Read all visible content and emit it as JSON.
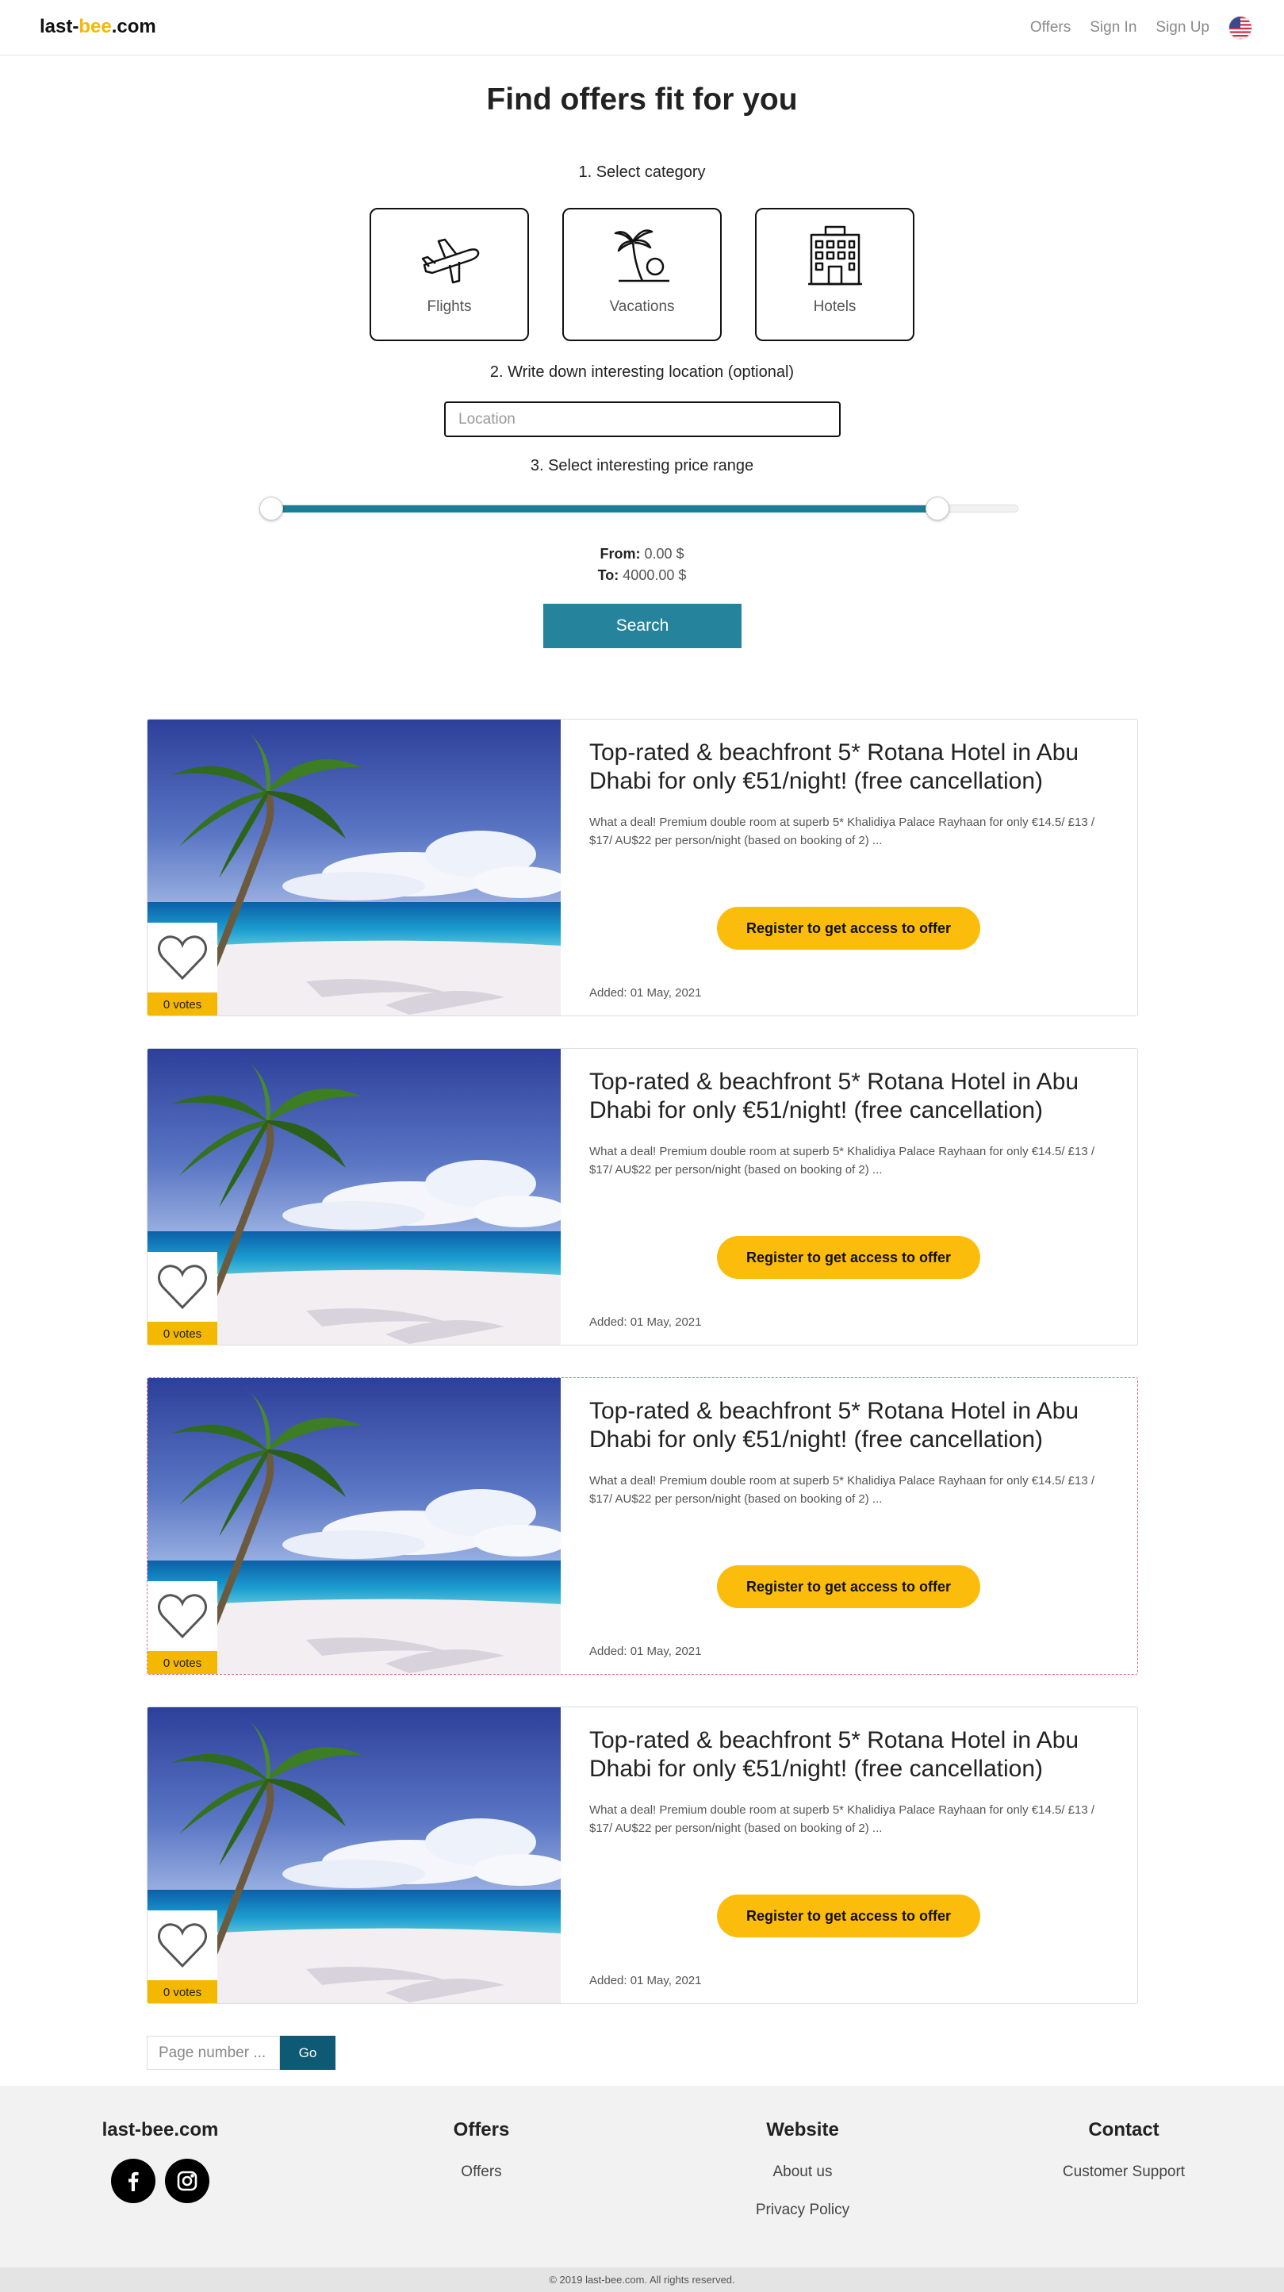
{
  "header": {
    "logo_part1": "last-",
    "logo_part2": "bee",
    "logo_part3": ".com",
    "nav": [
      "Offers",
      "Sign In",
      "Sign Up"
    ],
    "language_icon": "us-flag-icon"
  },
  "hero": {
    "title": "Find offers fit for you",
    "step1": "1. Select category",
    "categories": [
      {
        "label": "Flights",
        "icon": "airplane-icon"
      },
      {
        "label": "Vacations",
        "icon": "palm-tree-icon"
      },
      {
        "label": "Hotels",
        "icon": "hotel-building-icon"
      }
    ],
    "step2": "2. Write down interesting location (optional)",
    "location_placeholder": "Location",
    "step3": "3. Select interesting price range",
    "price_min": 0,
    "price_max": 4000,
    "from_label": "From:",
    "from_value": "0.00 $",
    "to_label": "To:",
    "to_value": "4000.00 $",
    "search_label": "Search"
  },
  "offers": [
    {
      "title": "Top-rated & beachfront 5* Rotana Hotel in Abu Dhabi for only €51/night! (free cancellation)",
      "description": "What a deal! Premium double room at superb 5* Khalidiya Palace Rayhaan for only €14.5/ £13 / $17/ AU$22 per person/night (based on booking of 2) ...",
      "cta": "Register to get access to offer",
      "added": "Added: 01 May, 2021",
      "votes": "0 votes"
    },
    {
      "title": "Top-rated & beachfront 5* Rotana Hotel in Abu Dhabi for only €51/night! (free cancellation)",
      "description": "What a deal! Premium double room at superb 5* Khalidiya Palace Rayhaan for only €14.5/ £13 / $17/ AU$22 per person/night (based on booking of 2) ...",
      "cta": "Register to get access to offer",
      "added": "Added: 01 May, 2021",
      "votes": "0 votes"
    },
    {
      "title": "Top-rated & beachfront 5* Rotana Hotel in Abu Dhabi for only €51/night! (free cancellation)",
      "description": "What a deal! Premium double room at superb 5* Khalidiya Palace Rayhaan for only €14.5/ £13 / $17/ AU$22 per person/night (based on booking of 2) ...",
      "cta": "Register to get access to offer",
      "added": "Added: 01 May, 2021",
      "votes": "0 votes"
    },
    {
      "title": "Top-rated & beachfront 5* Rotana Hotel in Abu Dhabi for only €51/night! (free cancellation)",
      "description": "What a deal! Premium double room at superb 5* Khalidiya Palace Rayhaan for only €14.5/ £13 / $17/ AU$22 per person/night (based on booking of 2) ...",
      "cta": "Register to get access to offer",
      "added": "Added: 01 May, 2021",
      "votes": "0 votes"
    }
  ],
  "pagination": {
    "placeholder": "Page number ...",
    "go_label": "Go"
  },
  "footer": {
    "brand": "last-bee.com",
    "social_icons": [
      "facebook-icon",
      "instagram-icon"
    ],
    "offers_heading": "Offers",
    "offers_links": [
      "Offers"
    ],
    "website_heading": "Website",
    "website_links": [
      "About us",
      "Privacy Policy"
    ],
    "contact_heading": "Contact",
    "contact_links": [
      "Customer Support"
    ],
    "copyright": "© 2019 last-bee.com. All rights reserved."
  },
  "colors": {
    "brand_yellow": "#f5b800",
    "cta_yellow": "#fcbc0b",
    "teal": "#25839c",
    "dark_teal": "#0e5973"
  }
}
